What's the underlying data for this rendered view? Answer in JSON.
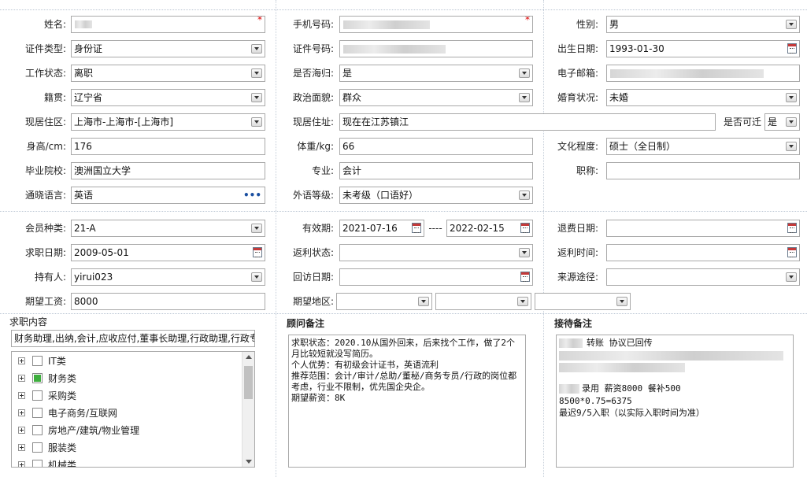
{
  "personal": {
    "name_label": "姓名:",
    "name_value": "",
    "phone_label": "手机号码:",
    "phone_value": "",
    "gender_label": "性别:",
    "gender_value": "男",
    "idtype_label": "证件类型:",
    "idtype_value": "身份证",
    "idno_label": "证件号码:",
    "idno_value": "",
    "birth_label": "出生日期:",
    "birth_value": "1993-01-30",
    "workstatus_label": "工作状态:",
    "workstatus_value": "离职",
    "returnee_label": "是否海归:",
    "returnee_value": "是",
    "email_label": "电子邮箱:",
    "email_value": "",
    "origin_label": "籍贯:",
    "origin_value": "辽宁省",
    "political_label": "政治面貌:",
    "political_value": "群众",
    "marital_label": "婚育状况:",
    "marital_value": "未婚",
    "region_label": "现居住区:",
    "region_value": "上海市-上海市-[上海市]",
    "address_label": "现居住址:",
    "address_value": "现在在江苏镇江",
    "relocate_label": "是否可迁",
    "relocate_value": "是",
    "height_label": "身高/cm:",
    "height_value": "176",
    "weight_label": "体重/kg:",
    "weight_value": "66",
    "education_label": "文化程度:",
    "education_value": "硕士（全日制）",
    "school_label": "毕业院校:",
    "school_value": "澳洲国立大学",
    "major_label": "专业:",
    "major_value": "会计",
    "title_label": "职称:",
    "title_value": "",
    "language_label": "通晓语言:",
    "language_value": "英语",
    "langlevel_label": "外语等级:",
    "langlevel_value": "未考级（口语好）"
  },
  "member": {
    "type_label": "会员种类:",
    "type_value": "21-A",
    "valid_label": "有效期:",
    "valid_from": "2021-07-16",
    "valid_sep": "----",
    "valid_to": "2022-02-15",
    "refund_label": "退费日期:",
    "refund_value": "",
    "jobdate_label": "求职日期:",
    "jobdate_value": "2009-05-01",
    "rebate_status_label": "返利状态:",
    "rebate_status_value": "",
    "rebate_time_label": "返利时间:",
    "rebate_time_value": "",
    "holder_label": "持有人:",
    "holder_value": "yirui023",
    "visit_label": "回访日期:",
    "visit_value": "",
    "source_label": "来源途径:",
    "source_value": "",
    "salary_label": "期望工资:",
    "salary_value": "8000",
    "area_label": "期望地区:",
    "area_values": [
      "",
      "",
      ""
    ]
  },
  "job_content": {
    "title": "求职内容",
    "summary": "财务助理,出纳,会计,应收应付,董事长助理,行政助理,行政专",
    "items": [
      {
        "label": "IT类",
        "checked": false
      },
      {
        "label": "财务类",
        "checked": true
      },
      {
        "label": "采购类",
        "checked": false
      },
      {
        "label": "电子商务/互联网",
        "checked": false
      },
      {
        "label": "房地产/建筑/物业管理",
        "checked": false
      },
      {
        "label": "服装类",
        "checked": false
      },
      {
        "label": "机械类",
        "checked": false
      }
    ]
  },
  "advisor": {
    "title": "顾问备注",
    "text": "求职状态：2020.10从国外回来，后来找个工作，做了2个月比较短就没写简历。\n个人优势：有初级会计证书，英语流利\n推荐范围：会计/审计/总助/董秘/商务专员/行政的岗位都考虑，行业不限制，优先国企央企。\n期望薪资：8K"
  },
  "reception": {
    "title": "接待备注",
    "line1": "转账 协议已回传",
    "line2": "录用 薪资8000 餐补500",
    "line3": "8500*0.75=6375",
    "line4": "最迟9/5入职（以实际入职时间为准）"
  }
}
